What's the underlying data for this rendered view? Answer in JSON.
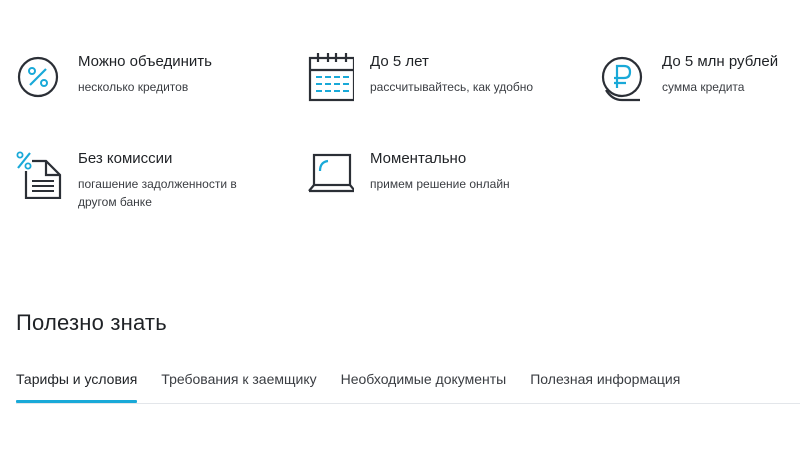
{
  "features": [
    {
      "title": "Можно объединить",
      "subtitle": "несколько кредитов",
      "icon": "percent-circle-icon"
    },
    {
      "title": "До 5 лет",
      "subtitle": "рассчитывайтесь, как удобно",
      "icon": "calendar-icon"
    },
    {
      "title": "До 5 млн рублей",
      "subtitle": "сумма кредита",
      "icon": "ruble-coin-icon"
    },
    {
      "title": "Без комиссии",
      "subtitle": "погашение задолженности в другом банке",
      "icon": "percent-document-icon"
    },
    {
      "title": "Моментально",
      "subtitle": "примем решение онлайн",
      "icon": "laptop-icon"
    }
  ],
  "section": {
    "title": "Полезно знать"
  },
  "tabs": [
    {
      "label": "Тарифы и условия",
      "active": true
    },
    {
      "label": "Требования к заемщику",
      "active": false
    },
    {
      "label": "Необходимые документы",
      "active": false
    },
    {
      "label": "Полезная информация",
      "active": false
    }
  ],
  "colors": {
    "accent": "#19a9d8",
    "dark": "#2b2f36",
    "text": "#1f2226"
  }
}
